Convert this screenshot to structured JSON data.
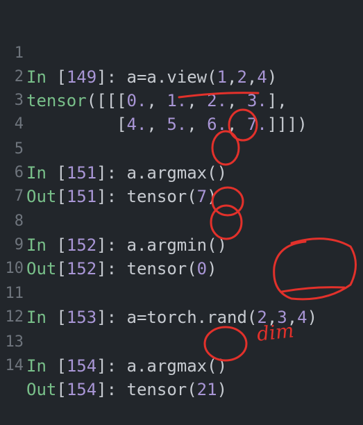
{
  "lines": [
    {
      "n": "1",
      "text": "In [149]: a=a.view(1,2,4)"
    },
    {
      "n": "2",
      "text": "tensor([[[0., 1., 2., 3.],"
    },
    {
      "n": "3",
      "text": "         [4., 5., 6., 7.]]])"
    },
    {
      "n": "4",
      "text": ""
    },
    {
      "n": "5",
      "text": "In [151]: a.argmax()"
    },
    {
      "n": "6",
      "text": "Out[151]: tensor(7)"
    },
    {
      "n": "7",
      "text": ""
    },
    {
      "n": "8",
      "text": "In [152]: a.argmin()"
    },
    {
      "n": "9",
      "text": "Out[152]: tensor(0)"
    },
    {
      "n": "10",
      "text": ""
    },
    {
      "n": "11",
      "text": "In [153]: a=torch.rand(2,3,4)"
    },
    {
      "n": "12",
      "text": ""
    },
    {
      "n": "13",
      "text": "In [154]: a.argmax()"
    },
    {
      "n": "14",
      "text": "Out[154]: tensor(21)"
    }
  ],
  "annotation_text": "dim",
  "colors": {
    "background": "#22262b",
    "keyword": "#79c08a",
    "number": "#a996d6",
    "text": "#c7cbd1",
    "line_number": "#6f757d",
    "annotation": "#e2312b"
  }
}
